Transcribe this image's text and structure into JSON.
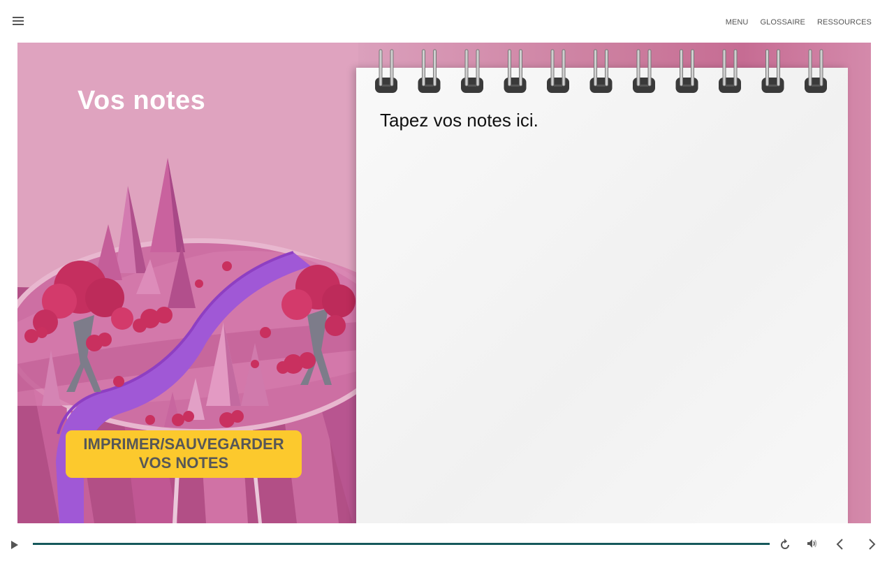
{
  "nav": {
    "menu_label": "MENU",
    "glossary_label": "GLOSSAIRE",
    "resources_label": "RESSOURCES"
  },
  "slide": {
    "title": "Vos notes",
    "notes_placeholder": "Tapez vos notes ici.",
    "print_button": {
      "line1": "IMPRIMER/SAUVEGARDER",
      "line2": "VOS NOTES"
    }
  },
  "player": {
    "progress": 1.0
  },
  "colors": {
    "accent": "#fcc92d",
    "progress": "#16585b",
    "panel_pink": "#dfa3bf",
    "river": "#a058d6"
  }
}
